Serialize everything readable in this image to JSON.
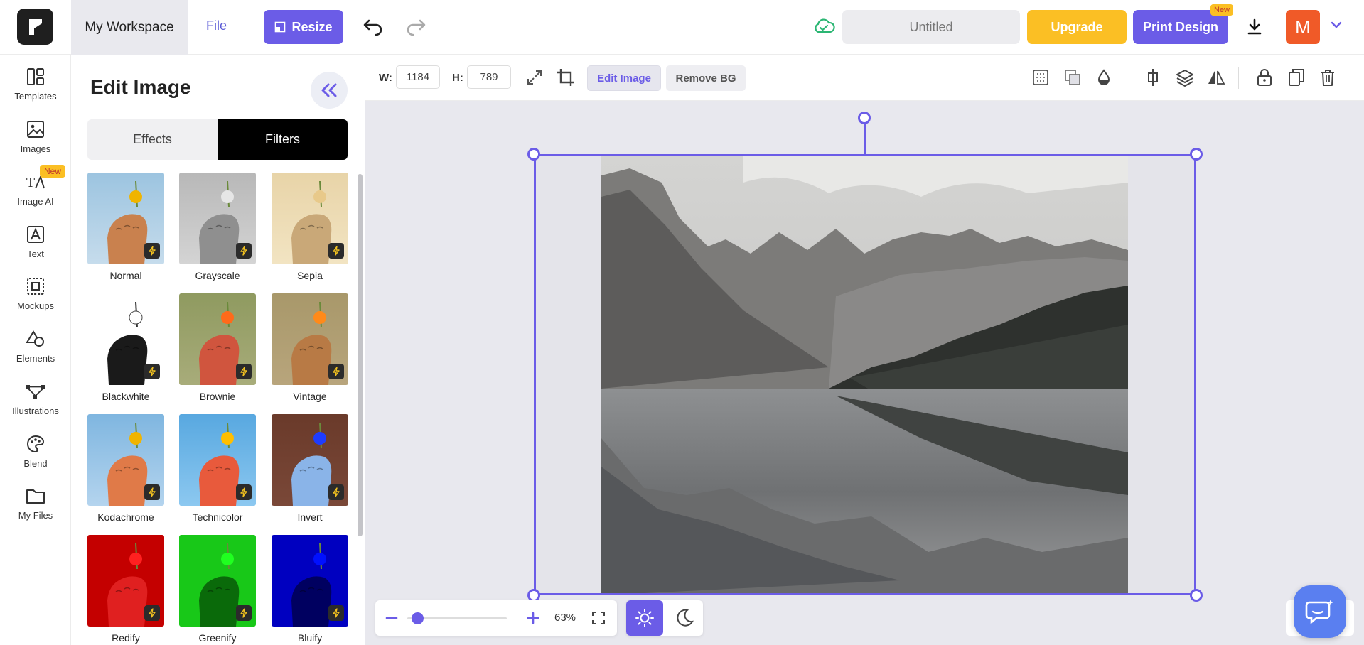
{
  "header": {
    "workspace_label": "My Workspace",
    "file_label": "File",
    "resize_label": "Resize",
    "title_value": "Untitled",
    "upgrade_label": "Upgrade",
    "print_label": "Print Design",
    "print_badge": "New",
    "avatar_letter": "M"
  },
  "rail": {
    "items": [
      {
        "label": "Templates",
        "icon": "templates-icon"
      },
      {
        "label": "Images",
        "icon": "images-icon"
      },
      {
        "label": "Image AI",
        "icon": "image-ai-icon"
      },
      {
        "label": "Text",
        "icon": "text-icon"
      },
      {
        "label": "Mockups",
        "icon": "mockups-icon"
      },
      {
        "label": "Elements",
        "icon": "elements-icon"
      },
      {
        "label": "Illustrations",
        "icon": "illustrations-icon"
      },
      {
        "label": "Blend",
        "icon": "blend-icon"
      },
      {
        "label": "My Files",
        "icon": "folder-icon"
      }
    ],
    "image_ai_badge": "New"
  },
  "panel": {
    "title": "Edit Image",
    "tabs": [
      "Effects",
      "Filters"
    ],
    "active_tab": "Filters",
    "filters": [
      {
        "label": "Normal"
      },
      {
        "label": "Grayscale"
      },
      {
        "label": "Sepia"
      },
      {
        "label": "Blackwhite"
      },
      {
        "label": "Brownie"
      },
      {
        "label": "Vintage"
      },
      {
        "label": "Kodachrome"
      },
      {
        "label": "Technicolor"
      },
      {
        "label": "Invert"
      },
      {
        "label": "Redify"
      },
      {
        "label": "Greenify"
      },
      {
        "label": "Bluify"
      }
    ]
  },
  "toolbar": {
    "w_label": "W:",
    "w_value": "1184",
    "h_label": "H:",
    "h_value": "789",
    "edit_image_label": "Edit Image",
    "remove_bg_label": "Remove BG"
  },
  "zoom": {
    "value": "63%",
    "level": 0.05
  },
  "colors": {
    "accent": "#6b5ce7",
    "upgrade": "#fbbf24",
    "avatar": "#f05a28",
    "canvas_bg": "#e8e8ee"
  }
}
